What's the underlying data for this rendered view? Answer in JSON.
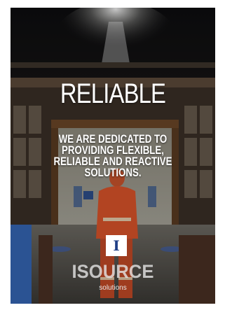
{
  "headline": "RELIABLE",
  "tagline": "WE ARE DEDICATED TO\nPROVIDING FLEXIBLE,\nRELIABLE AND REACTIVE\nSOLUTIONS.",
  "logo": {
    "mark": "I",
    "wordmark": "ISOURCE",
    "subtitle": "solutions"
  },
  "colors": {
    "logo_blue": "#1f3f86",
    "worker_orange": "#d9532a",
    "text": "#ffffff"
  }
}
